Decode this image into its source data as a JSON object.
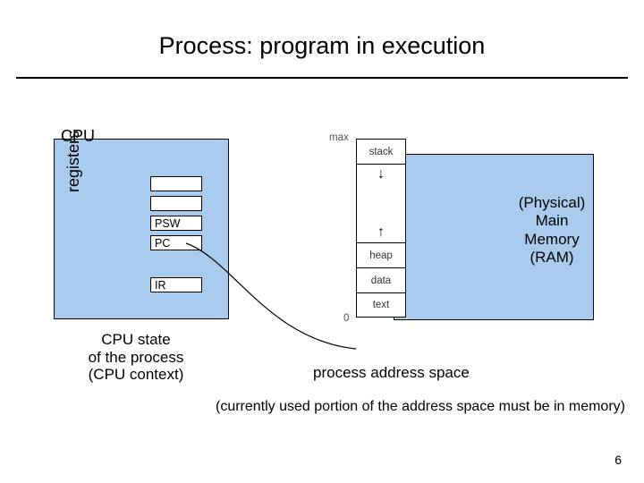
{
  "title": "Process: program in execution",
  "cpu": {
    "label": "CPU",
    "registers_label": "registers",
    "psw": "PSW",
    "pc": "PC",
    "ir": "IR",
    "state_caption": "CPU state\nof the process\n(CPU context)"
  },
  "memory": {
    "label": "(Physical)\nMain\nMemory\n(RAM)"
  },
  "address_space": {
    "max": "max",
    "zero": "0",
    "stack": "stack",
    "heap": "heap",
    "data": "data",
    "text": "text",
    "caption": "process address space"
  },
  "note": "(currently used portion of the address space must be in memory)",
  "page_number": "6",
  "chart_data": {
    "type": "diagram",
    "title": "Process: program in execution",
    "components": [
      {
        "name": "CPU",
        "contains": [
          "registers",
          "PSW",
          "PC",
          "IR"
        ],
        "caption": "CPU state of the process (CPU context)"
      },
      {
        "name": "Process Address Space",
        "segments_top_to_bottom": [
          "stack",
          "(gap growing both directions)",
          "heap",
          "data",
          "text"
        ],
        "range": {
          "top": "max",
          "bottom": "0"
        }
      },
      {
        "name": "Physical Main Memory (RAM)"
      }
    ],
    "relations": [
      {
        "from": "CPU.PC",
        "to": "Process Address Space",
        "type": "pointer"
      },
      {
        "from": "Process Address Space",
        "to": "Physical Main Memory",
        "type": "overlay",
        "note": "currently used portion of the address space must be in memory"
      }
    ]
  }
}
